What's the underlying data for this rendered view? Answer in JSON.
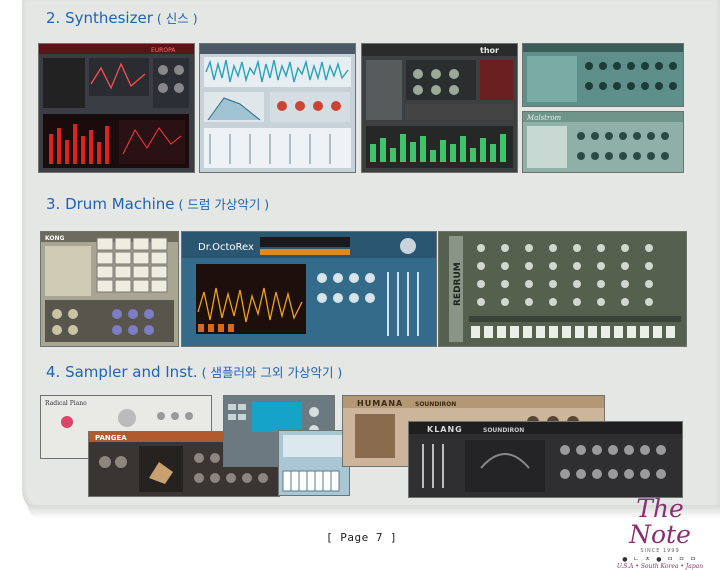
{
  "sections": [
    {
      "number": "2.",
      "title": "Synthesizer",
      "subtitle": "( 신스 )"
    },
    {
      "number": "3.",
      "title": "Drum Machine",
      "subtitle": "( 드럼 가상악기 )"
    },
    {
      "number": "4.",
      "title": "Sampler and Inst.",
      "subtitle": "( 샘플러와 그외 가상악기 )"
    }
  ],
  "device_labels": {
    "europa": "EUROPA",
    "thor": "thor",
    "malstrom": "Malstrom",
    "kong": "KONG",
    "dr_octo_rex": "Dr.OctoRex",
    "redrum": "REDRUM",
    "radical_piano": "Radical Piano",
    "pangea": "PANGEA",
    "humana": "HUMANA",
    "soundiron": "SOUNDIRON",
    "klang": "KLANG"
  },
  "footer": {
    "page_label": "[ Page 7 ]"
  },
  "logo": {
    "name": "The Note",
    "tagline": "SINCE 1999",
    "dots": "● ㄴ ㅈ ● ㅁ ㅁ ㅁ",
    "locations": "U.S.A • South Korea • Japan"
  }
}
